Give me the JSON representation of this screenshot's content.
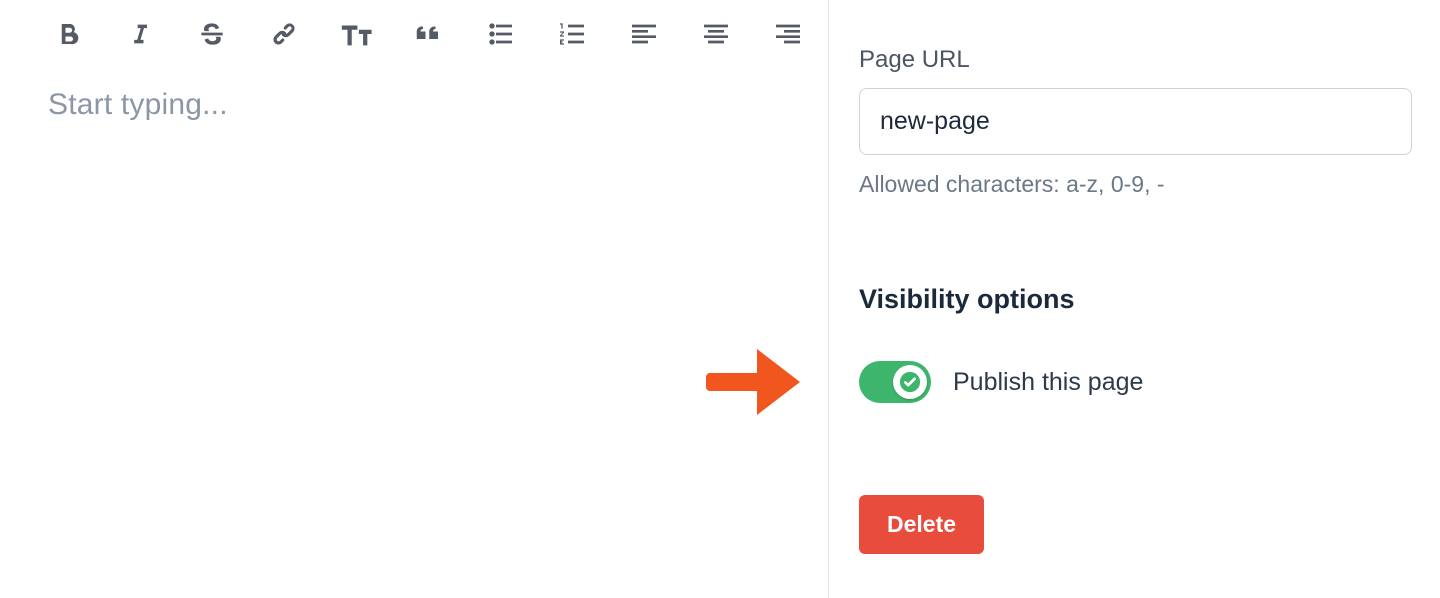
{
  "editor": {
    "placeholder": "Start typing..."
  },
  "toolbar": {
    "bold": "bold-button",
    "italic": "italic-button",
    "strike": "strikethrough-button",
    "link": "link-button",
    "textsize": "textsize-button",
    "quote": "quote-button",
    "ul": "unordered-list-button",
    "ol": "ordered-list-button",
    "align_left": "align-left-button",
    "align_center": "align-center-button",
    "align_right": "align-right-button"
  },
  "sidebar": {
    "page_url": {
      "label": "Page URL",
      "value": "new-page",
      "helper": "Allowed characters: a-z, 0-9, -"
    },
    "visibility": {
      "title": "Visibility options",
      "publish_label": "Publish this page",
      "publish_enabled": true
    },
    "delete_label": "Delete"
  },
  "colors": {
    "accent_green": "#3db56d",
    "danger_red": "#e74c3c",
    "annotation_orange": "#f2561f"
  }
}
